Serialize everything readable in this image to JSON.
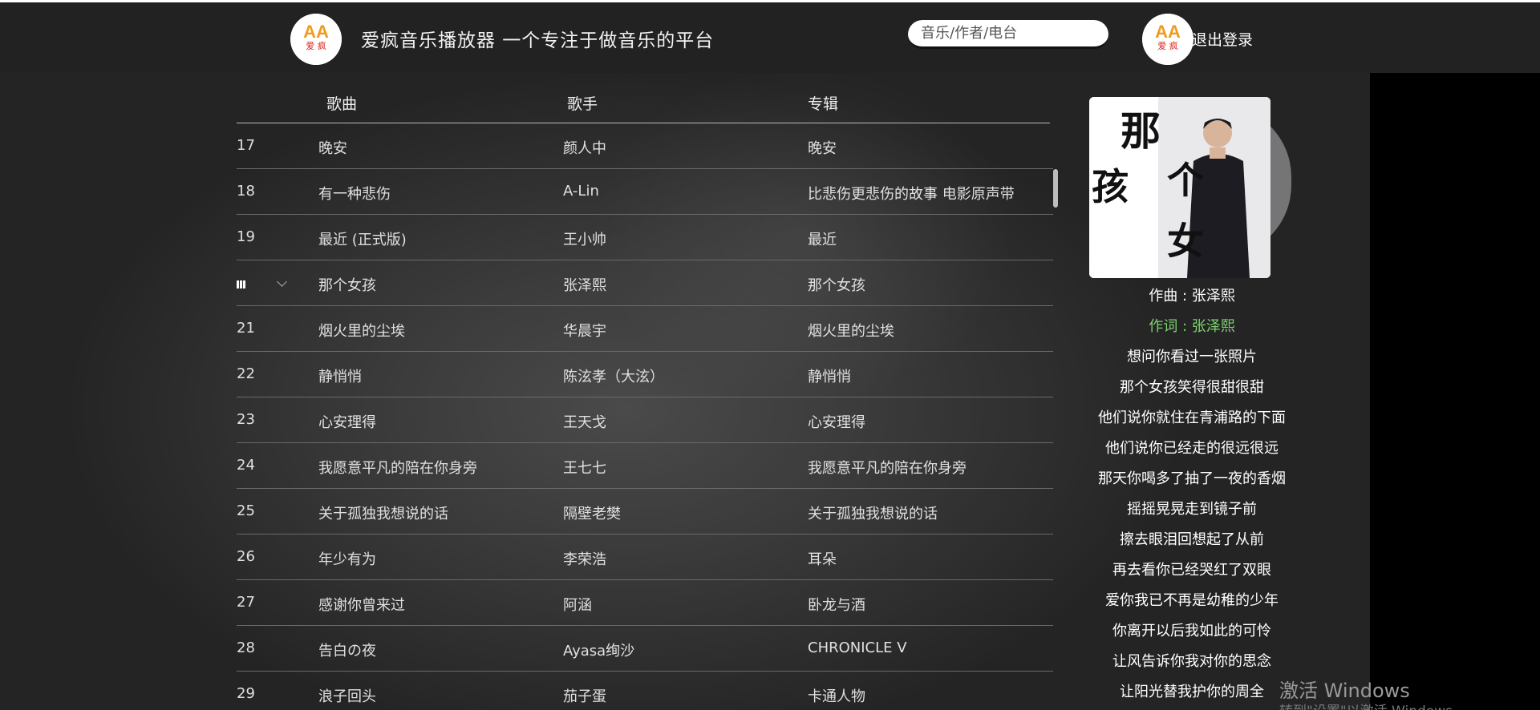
{
  "header": {
    "title": "爱疯音乐播放器  一个专注于做音乐的平台",
    "logo_text_a": "AA",
    "logo_text_b": "爱  疯",
    "search_placeholder": "音乐/作者/电台",
    "logout_label": "退出登录"
  },
  "table": {
    "columns": {
      "song": "歌曲",
      "singer": "歌手",
      "album": "专辑"
    },
    "rows": [
      {
        "num": "17",
        "song": "晚安",
        "singer": "颜人中",
        "album": "晚安"
      },
      {
        "num": "18",
        "song": "有一种悲伤",
        "singer": "A-Lin",
        "album": "比悲伤更悲伤的故事 电影原声带"
      },
      {
        "num": "19",
        "song": "最近 (正式版)",
        "singer": "王小帅",
        "album": "最近"
      },
      {
        "num": "",
        "song": "那个女孩",
        "singer": "张泽熙",
        "album": "那个女孩",
        "playing": true
      },
      {
        "num": "21",
        "song": "烟火里的尘埃",
        "singer": "华晨宇",
        "album": "烟火里的尘埃"
      },
      {
        "num": "22",
        "song": "静悄悄",
        "singer": "陈泫孝（大泫）",
        "album": "静悄悄"
      },
      {
        "num": "23",
        "song": "心安理得",
        "singer": "王天戈",
        "album": "心安理得"
      },
      {
        "num": "24",
        "song": "我愿意平凡的陪在你身旁",
        "singer": "王七七",
        "album": "我愿意平凡的陪在你身旁"
      },
      {
        "num": "25",
        "song": "关于孤独我想说的话",
        "singer": "隔壁老樊",
        "album": "关于孤独我想说的话"
      },
      {
        "num": "26",
        "song": "年少有为",
        "singer": "李荣浩",
        "album": "耳朵"
      },
      {
        "num": "27",
        "song": "感谢你曾来过",
        "singer": "阿涵",
        "album": "卧龙与酒"
      },
      {
        "num": "28",
        "song": "告白の夜",
        "singer": "Ayasa绚沙",
        "album": "CHRONICLE V"
      },
      {
        "num": "29",
        "song": "浪子回头",
        "singer": "茄子蛋",
        "album": "卡通人物"
      }
    ]
  },
  "now_playing": {
    "cover_title": "那个女孩",
    "lyrics": [
      {
        "text": "作曲 : 张泽熙",
        "active": false
      },
      {
        "text": "作词 : 张泽熙",
        "active": true
      },
      {
        "text": "想问你看过一张照片",
        "active": false
      },
      {
        "text": "那个女孩笑得很甜很甜",
        "active": false
      },
      {
        "text": "他们说你就住在青浦路的下面",
        "active": false
      },
      {
        "text": "他们说你已经走的很远很远",
        "active": false
      },
      {
        "text": "那天你喝多了抽了一夜的香烟",
        "active": false
      },
      {
        "text": "摇摇晃晃走到镜子前",
        "active": false
      },
      {
        "text": "擦去眼泪回想起了从前",
        "active": false
      },
      {
        "text": "再去看你已经哭红了双眼",
        "active": false
      },
      {
        "text": "爱你我已不再是幼稚的少年",
        "active": false
      },
      {
        "text": "你离开以后我如此的可怜",
        "active": false
      },
      {
        "text": "让风告诉你我对你的思念",
        "active": false
      },
      {
        "text": "让阳光替我护你的周全",
        "active": false
      }
    ],
    "active_color": "#7fd36e"
  },
  "watermark": {
    "line1": "激活 Windows",
    "line2": "转到\"设置\"以激活 Windows。"
  },
  "colors": {
    "header_bg": "#222222",
    "accent_orange": "#f29a1e",
    "logo_red": "#d9261c"
  }
}
